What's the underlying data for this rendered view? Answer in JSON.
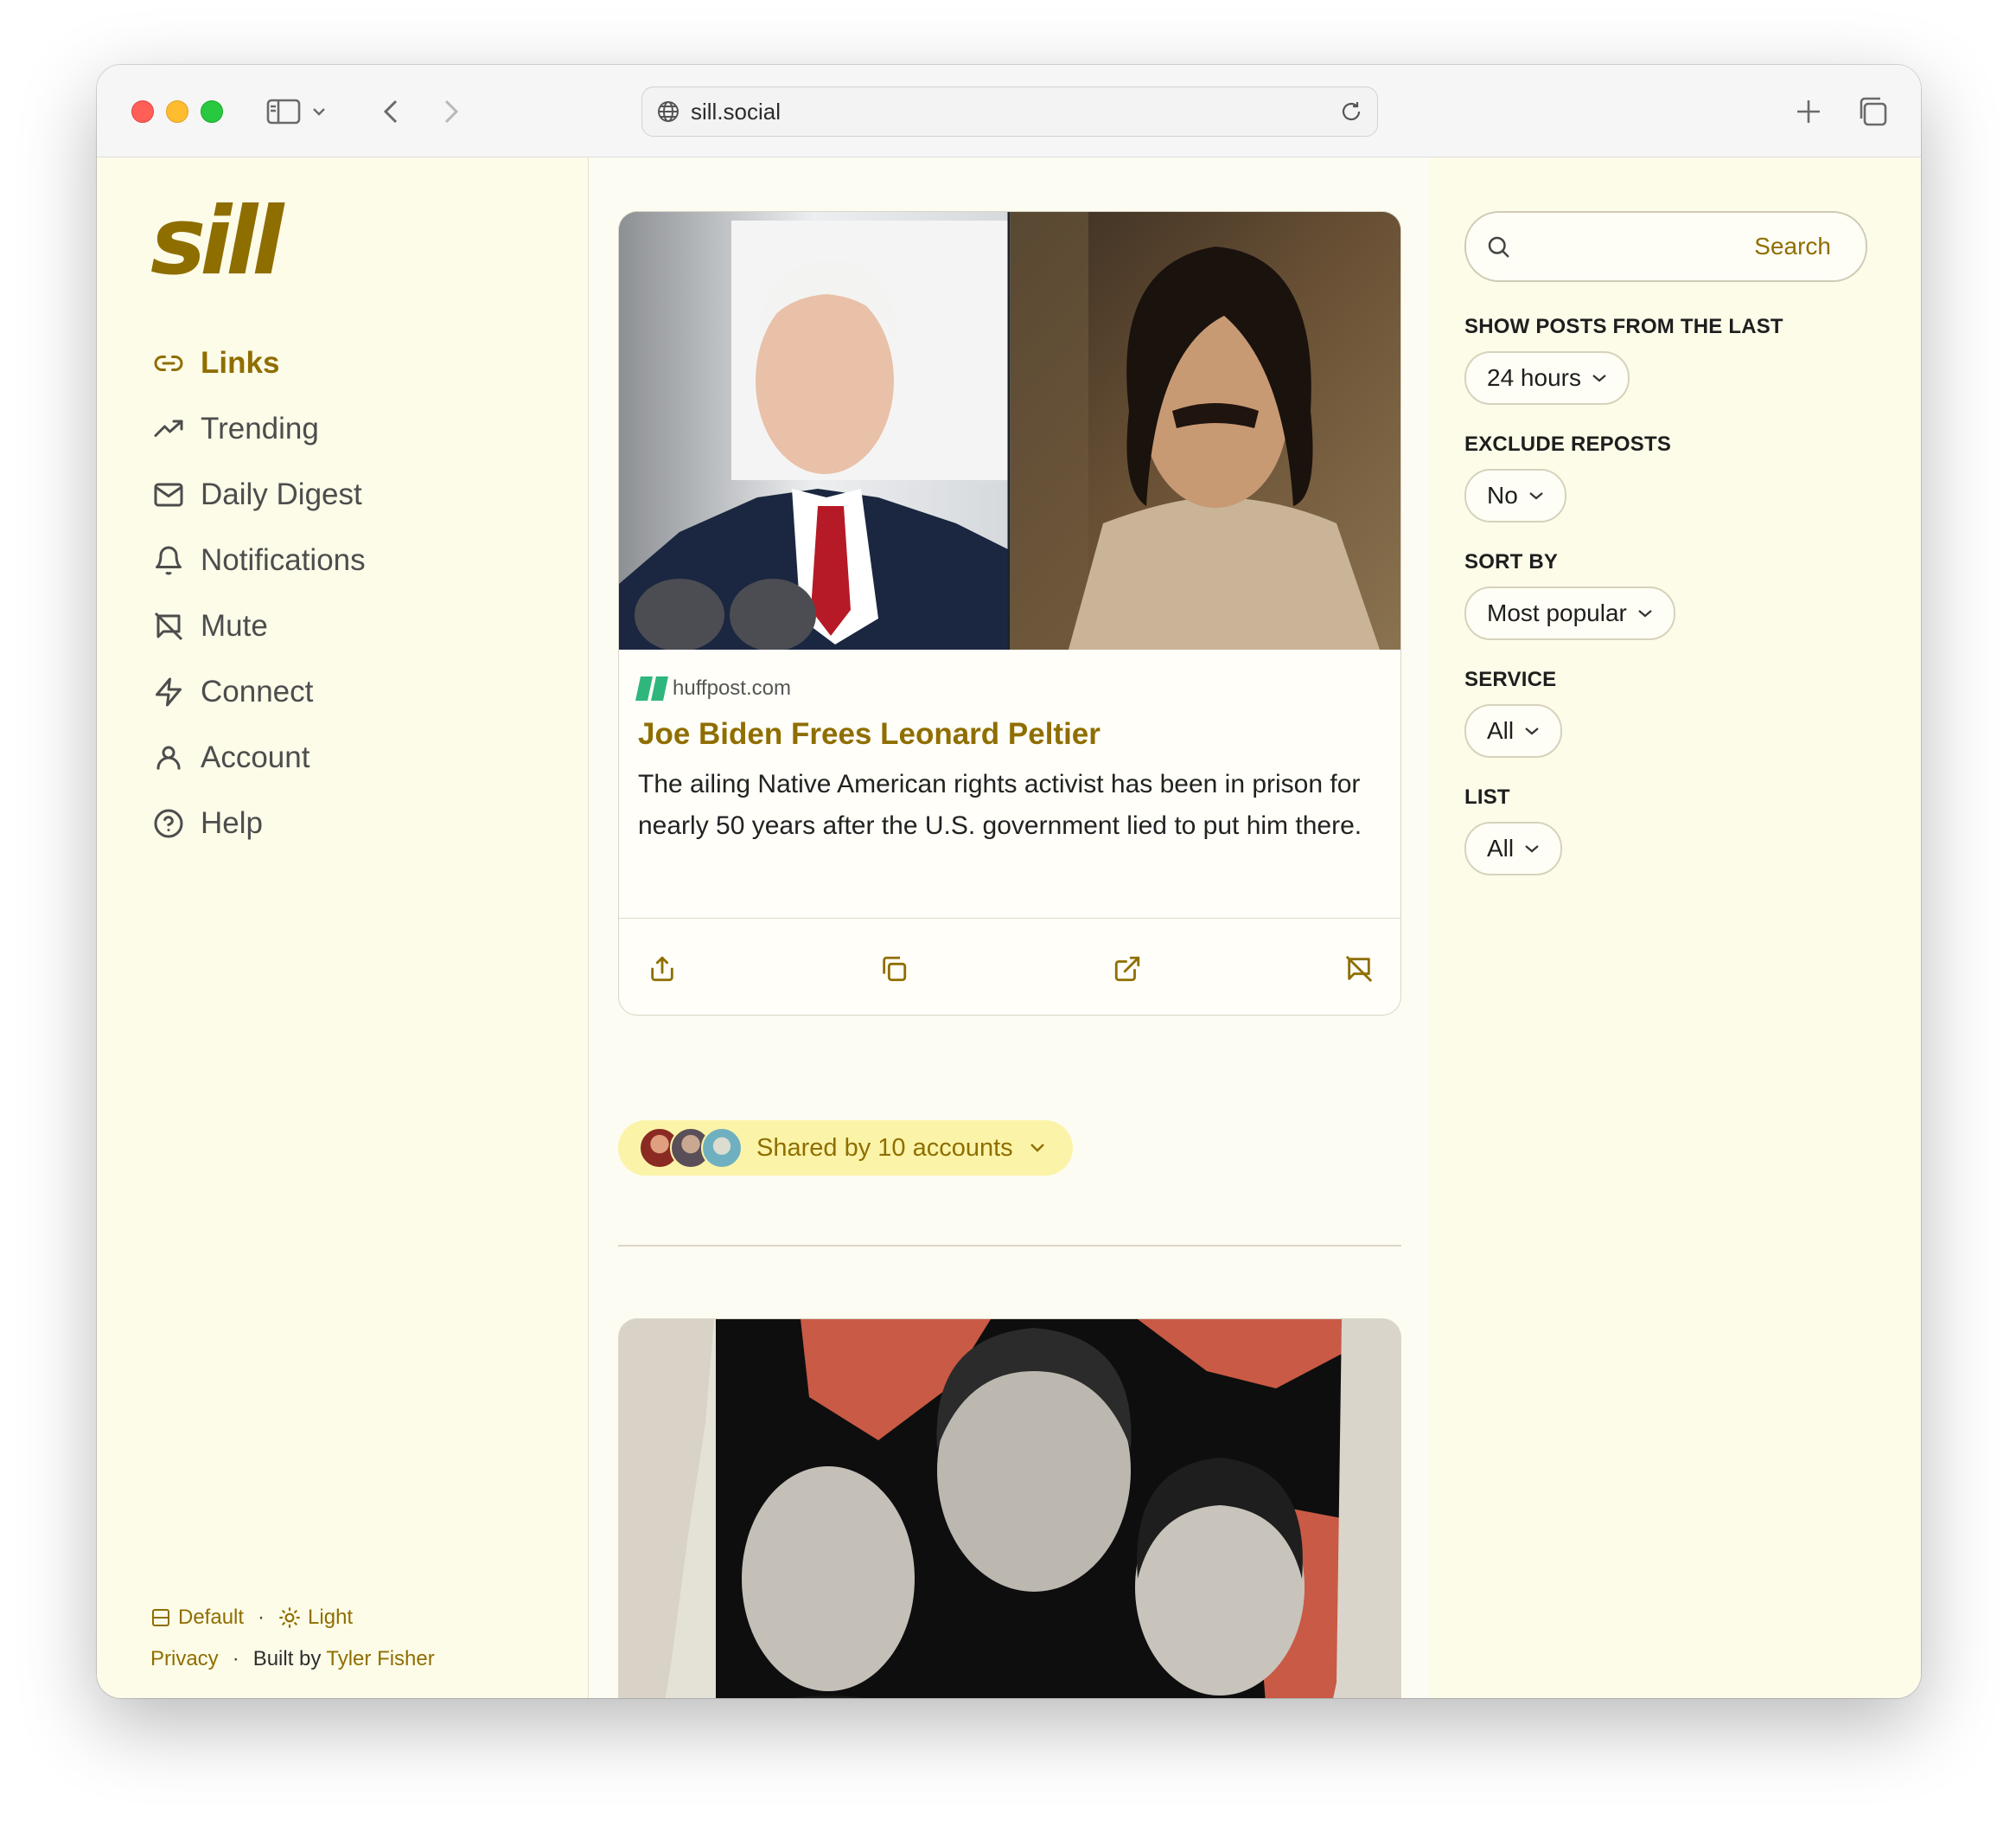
{
  "browser": {
    "url": "sill.social"
  },
  "app": {
    "logo": "sill"
  },
  "nav": {
    "items": [
      {
        "label": "Links",
        "icon": "link-icon",
        "active": true
      },
      {
        "label": "Trending",
        "icon": "trending-icon",
        "active": false
      },
      {
        "label": "Daily Digest",
        "icon": "mail-icon",
        "active": false
      },
      {
        "label": "Notifications",
        "icon": "bell-icon",
        "active": false
      },
      {
        "label": "Mute",
        "icon": "mute-icon",
        "active": false
      },
      {
        "label": "Connect",
        "icon": "zap-icon",
        "active": false
      },
      {
        "label": "Account",
        "icon": "user-icon",
        "active": false
      },
      {
        "label": "Help",
        "icon": "help-icon",
        "active": false
      }
    ]
  },
  "footer": {
    "layout_label": "Default",
    "theme_label": "Light",
    "privacy_label": "Privacy",
    "built_by_prefix": "Built by",
    "built_by_name": "Tyler Fisher"
  },
  "feed": {
    "card1": {
      "domain": "huffpost.com",
      "title": "Joe Biden Frees Leonard Peltier",
      "description": "The ailing Native American rights activist has been in prison for nearly 50 years after the U.S. government lied to put him there.",
      "actions": [
        "share-icon",
        "copy-icon",
        "external-link-icon",
        "mute-icon"
      ]
    },
    "shared": {
      "label": "Shared by 10 accounts"
    }
  },
  "sidebar": {
    "search_placeholder": "Search",
    "filters": {
      "time": {
        "label": "SHOW POSTS FROM THE LAST",
        "value": "24 hours"
      },
      "reposts": {
        "label": "EXCLUDE REPOSTS",
        "value": "No"
      },
      "sort": {
        "label": "SORT BY",
        "value": "Most popular"
      },
      "service": {
        "label": "SERVICE",
        "value": "All"
      },
      "list": {
        "label": "LIST",
        "value": "All"
      }
    }
  },
  "colors": {
    "accent": "#8f6e00",
    "background": "#fdfce9",
    "pill": "#fbf4a8"
  }
}
